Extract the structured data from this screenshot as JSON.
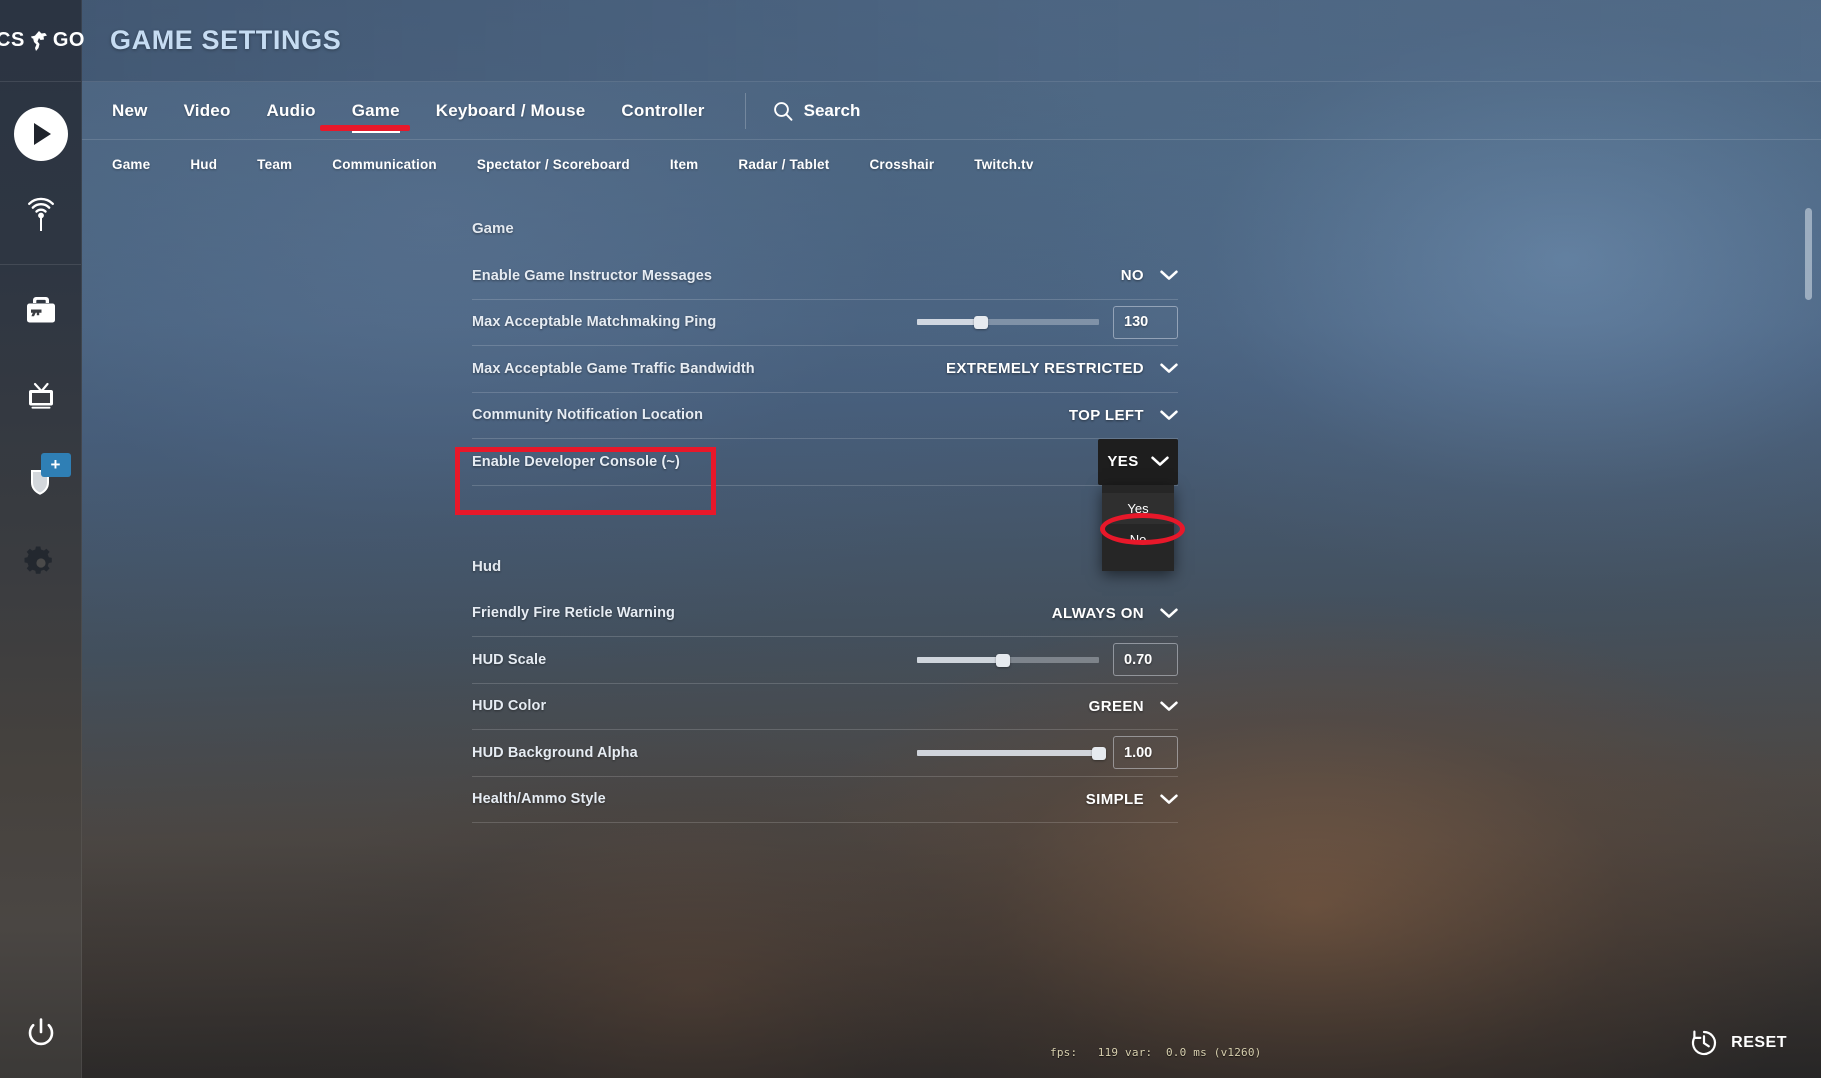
{
  "brand": {
    "name": "CS:GO",
    "left": "CS",
    "right": "GO"
  },
  "header": {
    "title": "GAME SETTINGS"
  },
  "rail": {
    "items": [
      {
        "name": "play-button",
        "label": "Play"
      },
      {
        "name": "watch-broadcast",
        "label": "Watch"
      },
      {
        "name": "inventory",
        "label": "Inventory"
      },
      {
        "name": "tv-broadcast",
        "label": "Broadcast"
      },
      {
        "name": "shield-upgrade",
        "label": "Upgrade",
        "badge": "+"
      },
      {
        "name": "settings-gear",
        "label": "Settings"
      }
    ],
    "power_label": "Quit"
  },
  "tabs": {
    "items": [
      {
        "label": "New",
        "active": false
      },
      {
        "label": "Video",
        "active": false
      },
      {
        "label": "Audio",
        "active": false
      },
      {
        "label": "Game",
        "active": true
      },
      {
        "label": "Keyboard / Mouse",
        "active": false
      },
      {
        "label": "Controller",
        "active": false
      }
    ],
    "search_label": "Search"
  },
  "subtabs": {
    "items": [
      {
        "label": "Game"
      },
      {
        "label": "Hud"
      },
      {
        "label": "Team"
      },
      {
        "label": "Communication"
      },
      {
        "label": "Spectator / Scoreboard"
      },
      {
        "label": "Item"
      },
      {
        "label": "Radar / Tablet"
      },
      {
        "label": "Crosshair"
      },
      {
        "label": "Twitch.tv"
      }
    ]
  },
  "sections": [
    {
      "title": "Game",
      "rows": [
        {
          "label": "Enable Game Instructor Messages",
          "type": "dropdown",
          "value": "NO"
        },
        {
          "label": "Max Acceptable Matchmaking Ping",
          "type": "slider",
          "value": "130",
          "percent": 35
        },
        {
          "label": "Max Acceptable Game Traffic Bandwidth",
          "type": "dropdown",
          "value": "EXTREMELY RESTRICTED"
        },
        {
          "label": "Community Notification Location",
          "type": "dropdown",
          "value": "TOP LEFT"
        },
        {
          "label": "Enable Developer Console (~)",
          "type": "dropdown-open",
          "value": "YES",
          "options": [
            {
              "label": "Yes",
              "selected": true
            },
            {
              "label": "No",
              "selected": false
            }
          ]
        }
      ]
    },
    {
      "title": "Hud",
      "rows": [
        {
          "label": "Friendly Fire Reticle Warning",
          "type": "dropdown",
          "value": "ALWAYS ON"
        },
        {
          "label": "HUD Scale",
          "type": "slider",
          "value": "0.70",
          "percent": 47
        },
        {
          "label": "HUD Color",
          "type": "dropdown",
          "value": "GREEN"
        },
        {
          "label": "HUD Background Alpha",
          "type": "slider",
          "value": "1.00",
          "percent": 100
        },
        {
          "label": "Health/Ammo Style",
          "type": "dropdown",
          "value": "SIMPLE"
        }
      ]
    }
  ],
  "bottom": {
    "fps_text": "fps:   119 var:  0.0 ms (v1260)",
    "reset_label": "RESET"
  },
  "colors": {
    "annotation_red": "#e8182a",
    "accent_blue": "#2f7fb5",
    "title_blue": "#c6dcf2"
  }
}
